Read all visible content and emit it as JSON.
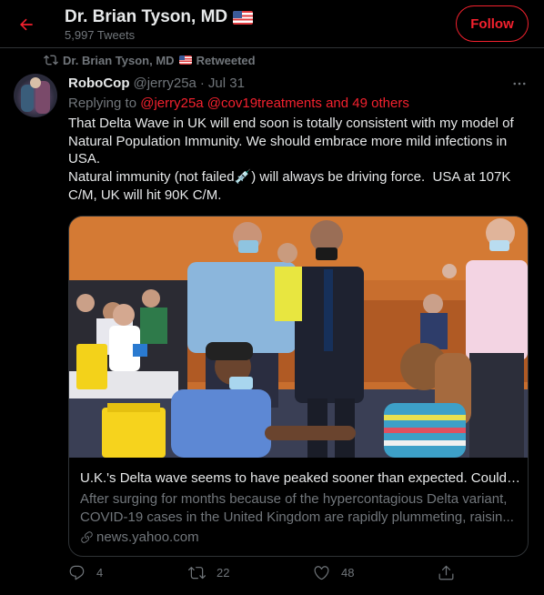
{
  "header": {
    "title": "Dr. Brian Tyson, MD",
    "tweet_count": "5,997 Tweets",
    "follow_label": "Follow"
  },
  "retweet_banner": {
    "name": "Dr. Brian Tyson, MD",
    "label": "Retweeted"
  },
  "tweet": {
    "display_name": "RoboCop",
    "handle": "@jerry25a",
    "separator": "·",
    "date": "Jul 31",
    "replying_prefix": "Replying to",
    "replying_mentions": "@jerry25a @cov19treatments and 49 others",
    "text": "That Delta Wave in UK will end soon is totally consistent with my model of Natural Population Immunity. We should embrace more mild infections in USA.\nNatural immunity (not failed💉) will always be driving force.  USA at 107K C/M, UK will hit 90K C/M."
  },
  "card": {
    "title": "U.K.'s Delta wave seems to have peaked sooner than expected. Could t...",
    "description": "After surging for months because of the hypercontagious Delta variant, COVID-19 cases in the United Kingdom are rapidly plummeting, raisin...",
    "domain": "news.yahoo.com"
  },
  "actions": {
    "replies": "4",
    "retweets": "22",
    "likes": "48"
  },
  "colors": {
    "accent": "#f4212e",
    "muted": "#71767b",
    "text": "#e7e9ea",
    "border": "#2f3336",
    "background": "#000000"
  }
}
